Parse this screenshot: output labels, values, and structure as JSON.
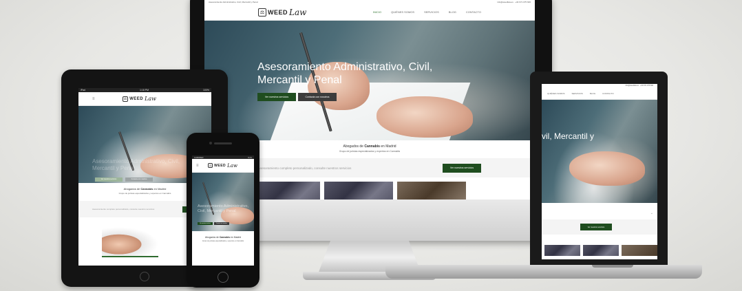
{
  "colors": {
    "brand_green": "#1f4d1f",
    "nav_active": "#3a7a3a",
    "hero_dark": "#2d4a58",
    "button_grey": "#3c3c3c"
  },
  "site": {
    "topbar_left": "Asesoramiento Administrativo, Civil, Mercantil y Penal",
    "topbar_right": "info@weedlaw.es · +34 671 075 606",
    "logo_weed": "WEED",
    "logo_law": "Law",
    "nav": [
      "INICIO",
      "QUIÉNES SOMOS",
      "SERVICIOS",
      "BLOG",
      "CONTACTO"
    ],
    "hero_title": "Asesoramiento Administrativo, Civil, Mercantil y Penal",
    "btn_services": "Ver nuestros servicios",
    "btn_contact": "Contacta con nosotros",
    "about_line_prefix": "Abogados de",
    "about_line_bold": "Cannabis",
    "about_line_suffix": "en Madrid",
    "about_sub": "Grupo de juristas especializados y expertos en Cannabis",
    "cta_text": "Asesoramiento completo personalizado, consulte nuestros servicios",
    "cta_button": "Ver nuestros servicios"
  },
  "laptop": {
    "hero_fragment": "vil, Mercantil y",
    "nav": [
      "QUIÉNES SOMOS",
      "SERVICIOS",
      "BLOG",
      "CONTACTO"
    ]
  },
  "tablet": {
    "status_left": "iPad",
    "status_center": "1:18 PM",
    "status_right": "100%",
    "menu_icon": "≡"
  },
  "phone": {
    "status_left": "CARRIER",
    "status_center": "9:41",
    "menu_icon": "≡"
  }
}
